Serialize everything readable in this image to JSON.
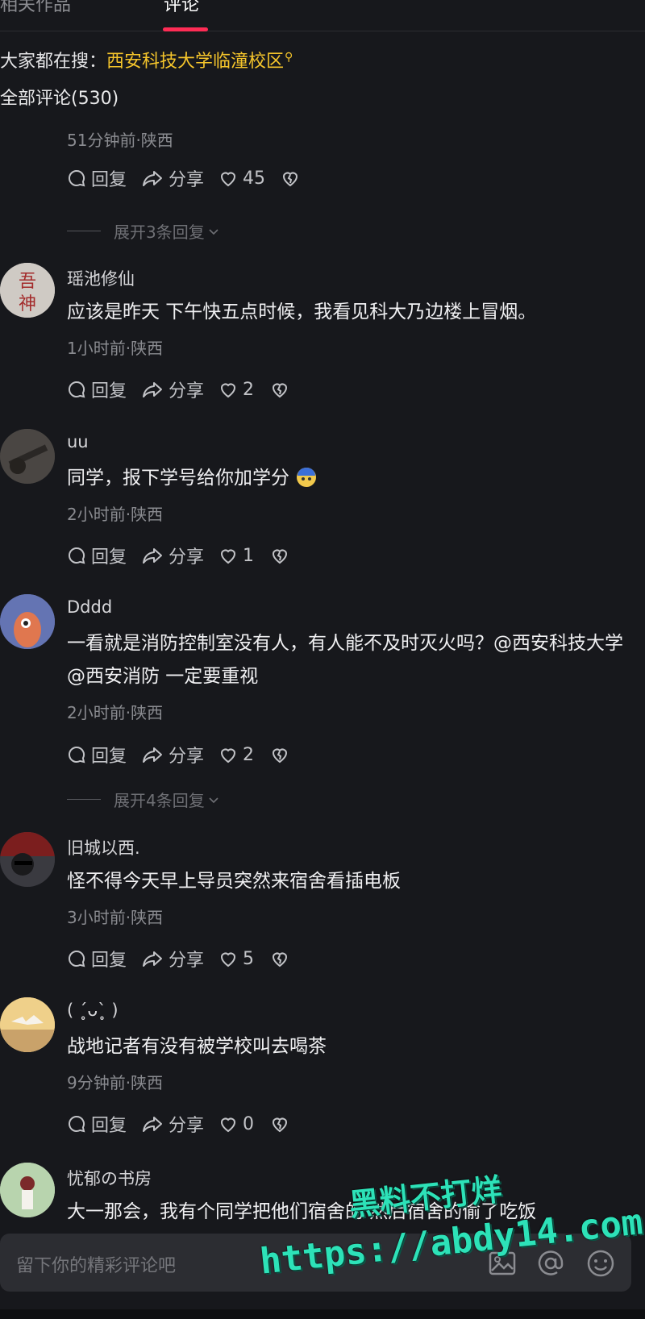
{
  "tabs": [
    "相关作品",
    "评论"
  ],
  "search": {
    "label": "大家都在搜：",
    "keyword": "西安科技大学临潼校区"
  },
  "all_comments": "全部评论(530)",
  "top_partial": {
    "meta": "51分钟前·陕西",
    "like_count": "45",
    "expand": "展开3条回复"
  },
  "actions": {
    "reply": "回复",
    "share": "分享"
  },
  "comments": [
    {
      "user": "瑶池修仙",
      "text": "应该是昨天 下午快五点时候，我看见科大乃边楼上冒烟。",
      "meta": "1小时前·陕西",
      "likes": "2",
      "avatar_text": "吾神"
    },
    {
      "user": "uu",
      "text": "同学，报下学号给你加学分 ",
      "meta": "2小时前·陕西",
      "likes": "1"
    },
    {
      "user": "Dddd",
      "text": "一看就是消防控制室没有人，有人能不及时灭火吗？@西安科技大学 @西安消防 一定要重视",
      "meta": "2小时前·陕西",
      "likes": "2",
      "expand": "展开4条回复"
    },
    {
      "user": "旧城以西.",
      "text": "怪不得今天早上导员突然来宿舍看插电板",
      "meta": "3小时前·陕西",
      "likes": "5"
    },
    {
      "user": "( ˊ̥ᴗˋ̥ )",
      "text": "战地记者有没有被学校叫去喝茶",
      "meta": "9分钟前·陕西",
      "likes": "0"
    },
    {
      "user": "忧郁の书房",
      "text": "大一那会，我有个同学把他们宿舍的 然后宿舍的偷了吃饭",
      "meta": ""
    }
  ],
  "input": {
    "placeholder": "留下你的精彩评论吧"
  },
  "watermark": {
    "line1": "黑料不打烊",
    "line2": "https://abdy14.com"
  },
  "colors": {
    "accent": "#fe2c55",
    "keyword": "#f5c52b",
    "watermark": "#2de2b8",
    "background": "#17181c"
  }
}
